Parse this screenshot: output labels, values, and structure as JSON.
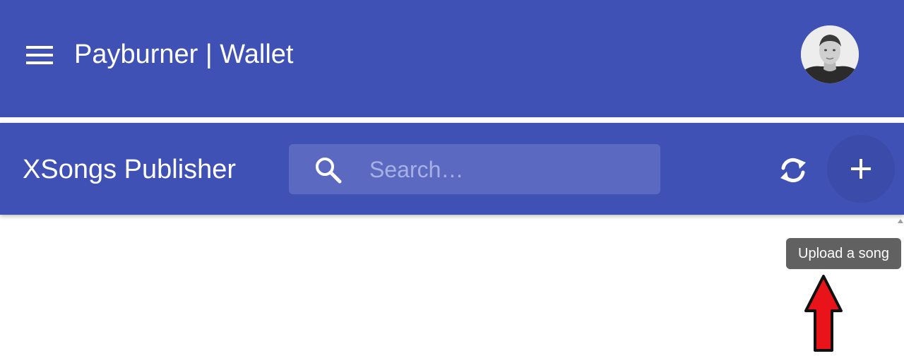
{
  "app_bar": {
    "title": "Payburner | Wallet",
    "menu_icon": "hamburger-menu-icon",
    "avatar_alt": "User avatar"
  },
  "toolbar": {
    "title": "XSongs Publisher",
    "search": {
      "placeholder": "Search…",
      "value": "",
      "icon": "search-icon"
    },
    "refresh_icon": "refresh-icon",
    "add_icon": "plus-icon"
  },
  "tooltip": {
    "text": "Upload a song"
  },
  "annotation": {
    "arrow_icon": "red-arrow-icon"
  },
  "colors": {
    "primary": "#3f51b5",
    "tooltip_bg": "#616161",
    "arrow": "#e8141a"
  }
}
